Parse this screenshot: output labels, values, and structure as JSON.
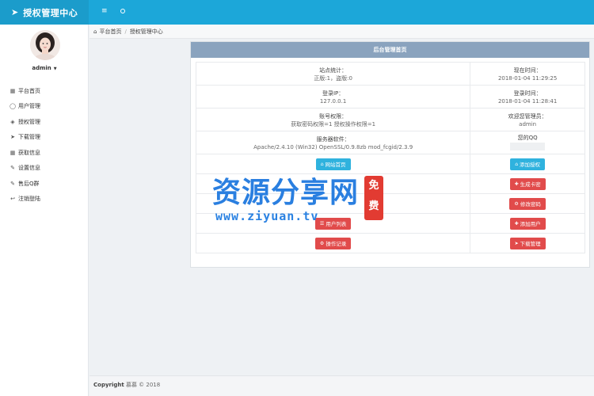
{
  "app": {
    "title": "授权管理中心"
  },
  "user": {
    "name": "admin"
  },
  "sidebar": {
    "items": [
      {
        "label": "平台首页",
        "icon": "grid-icon"
      },
      {
        "label": "用户管理",
        "icon": "user-icon"
      },
      {
        "label": "授权管理",
        "icon": "layers-icon"
      },
      {
        "label": "下载管理",
        "icon": "rocket-icon"
      },
      {
        "label": "获取信息",
        "icon": "grid-icon"
      },
      {
        "label": "设置信息",
        "icon": "edit-icon"
      },
      {
        "label": "售后Q群",
        "icon": "edit-icon"
      },
      {
        "label": "注销登陆",
        "icon": "logout-icon"
      }
    ]
  },
  "breadcrumb": {
    "home": "平台首页",
    "current": "授权管理中心"
  },
  "panel": {
    "title": "后台管理首页",
    "stats": {
      "label": "站点统计：",
      "value": "正版:1，盗版:0"
    },
    "time": {
      "label": "现在时间：",
      "value": "2018-01-04 11:29:25"
    },
    "login_ip": {
      "label": "登录IP：",
      "value": "127.0.0.1"
    },
    "login_time": {
      "label": "登录时间：",
      "value": "2018-01-04 11:28:41"
    },
    "perms": {
      "label": "账号权限：",
      "value": "获取密码权限=1 授权操作权限=1"
    },
    "welcome": {
      "label": "欢迎您管理员：",
      "value": "admin"
    },
    "server": {
      "label": "服务器软件：",
      "value": "Apache/2.4.10 (Win32) OpenSSL/0.9.8zb mod_fcgid/2.3.9"
    },
    "qq": {
      "label": "您的QQ",
      "value": ""
    },
    "buttons": {
      "site_home": "网站首页",
      "add_auth": "添加授权",
      "gen_card": "生成卡密",
      "change_pwd": "修改密码",
      "user_list": "用户列表",
      "add_user": "添加用户",
      "op_log": "操作记录",
      "download_mgmt": "下载管理"
    }
  },
  "watermark": {
    "cn": "资源分享网",
    "url": "www.ziyuan.tv",
    "stamp": "免费"
  },
  "footer": {
    "copyright": "Copyright",
    "text": "慕慕 © 2018"
  },
  "colors": {
    "topbar": "#1ca7d9",
    "panel_head": "#8aa3be",
    "btn_blue": "#2fb2de",
    "btn_red": "#e14b4b"
  }
}
